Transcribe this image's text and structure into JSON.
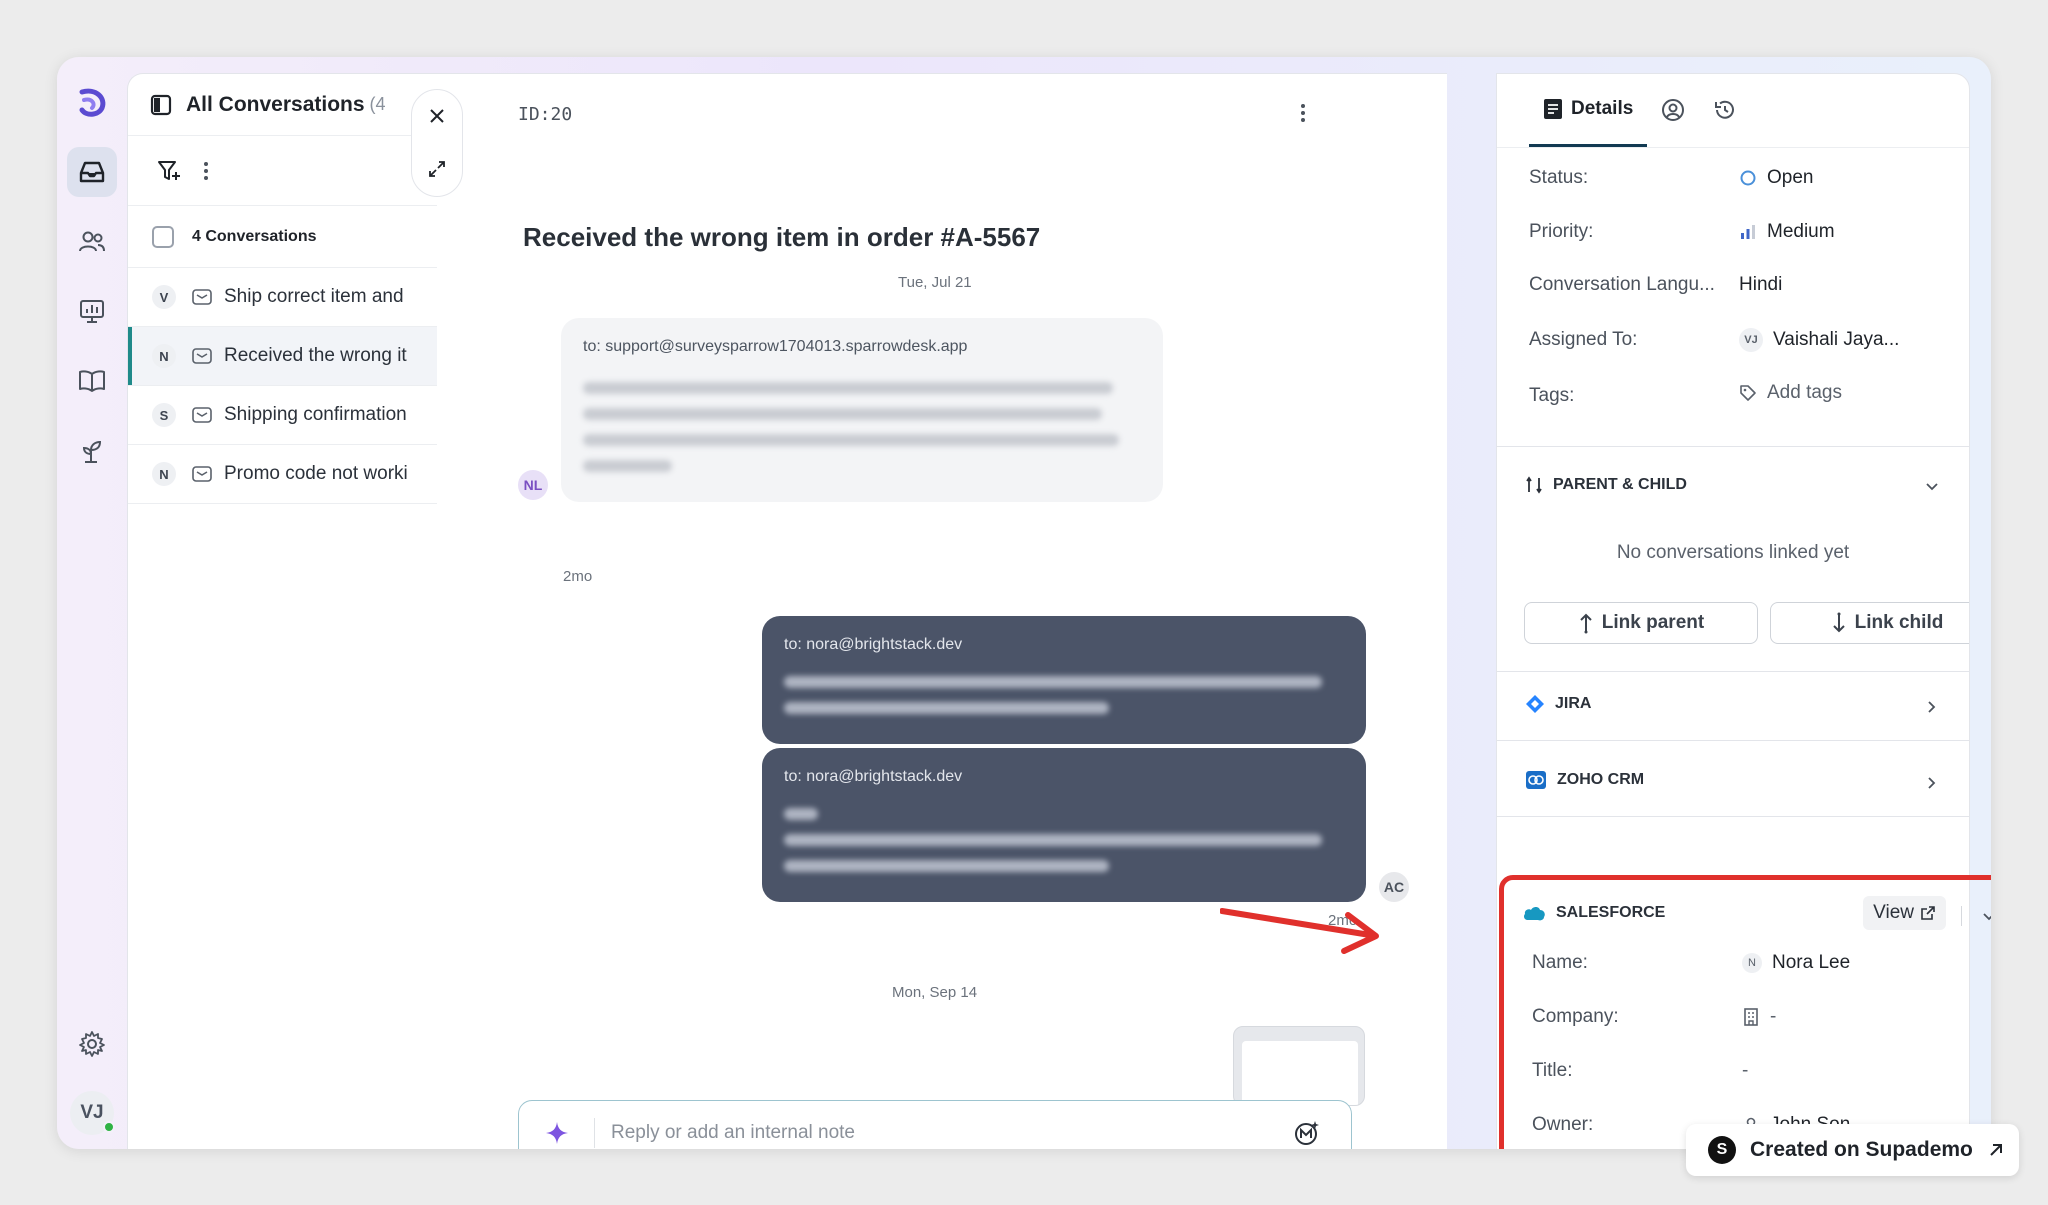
{
  "nav": {
    "items": [
      "logo",
      "inbox",
      "contacts",
      "reports",
      "knowledge-base",
      "automation",
      "settings"
    ],
    "user_initials": "VJ"
  },
  "list": {
    "title": "All Conversations",
    "count": "(4",
    "select_label": "4 Conversations",
    "items": [
      {
        "initial": "V",
        "subject": "Ship correct item and"
      },
      {
        "initial": "N",
        "subject": "Received the wrong it"
      },
      {
        "initial": "S",
        "subject": "Shipping confirmation"
      },
      {
        "initial": "N",
        "subject": "Promo code not worki"
      }
    ]
  },
  "chat": {
    "id": "ID:20",
    "subject": "Received the wrong item in order #A-5567",
    "date1": "Tue, Jul 21",
    "date2": "Mon, Sep 14",
    "msg1_to": "to: support@surveysparrow1704013.sparrowdesk.app",
    "msg1_avatar": "NL",
    "msg1_time": "2mo",
    "msg2_to": "to: nora@brightstack.dev",
    "msg3_to": "to: nora@brightstack.dev",
    "msg3_avatar": "AC",
    "msg3_time": "2mo",
    "reply_placeholder": "Reply or add an internal note"
  },
  "details": {
    "tab_details": "Details",
    "status_label": "Status:",
    "status_value": "Open",
    "priority_label": "Priority:",
    "priority_value": "Medium",
    "language_label": "Conversation Langu...",
    "language_value": "Hindi",
    "assigned_label": "Assigned To:",
    "assigned_initials": "VJ",
    "assigned_value": "Vaishali Jaya...",
    "tags_label": "Tags:",
    "tags_value": "Add tags",
    "parent_child_title": "PARENT & CHILD",
    "no_links": "No conversations linked yet",
    "link_parent": "Link parent",
    "link_child": "Link child",
    "jira_title": "JIRA",
    "zoho_title": "ZOHO CRM",
    "salesforce_title": "SALESFORCE",
    "sf_view": "View",
    "sf_name_label": "Name:",
    "sf_name_initial": "N",
    "sf_name_value": "Nora Lee",
    "sf_company_label": "Company:",
    "sf_company_value": "-",
    "sf_title_label": "Title:",
    "sf_title_value": "-",
    "sf_owner_label": "Owner:",
    "sf_owner_value": "John Son"
  },
  "footer": {
    "supademo_logo": "S",
    "supademo_text": "Created on Supademo"
  },
  "colors": {
    "accent_teal": "#1f8a8a",
    "message_dark": "#4b5468",
    "highlight_red": "#e0302c",
    "status_open": "#4a90d9",
    "salesforce_blue": "#1798c1"
  }
}
